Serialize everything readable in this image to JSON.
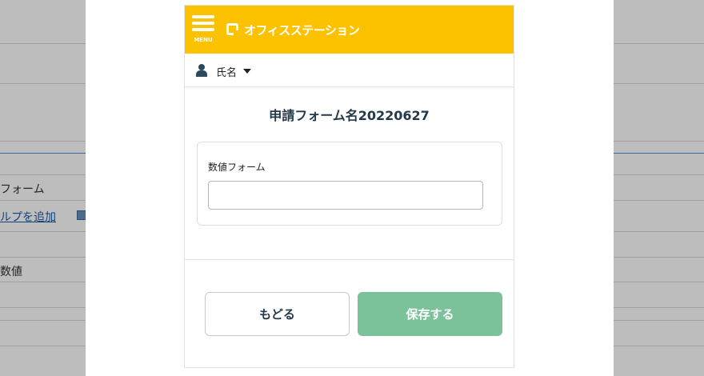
{
  "background": {
    "row1": "フォーム",
    "row2_link": "ルプを追加",
    "row3": "数値"
  },
  "app": {
    "menu_label": "MENU",
    "logo_text": "オフィスステーション"
  },
  "user": {
    "name": "氏名"
  },
  "form": {
    "title": "申請フォーム名20220627",
    "field_label": "数値フォーム",
    "field_value": ""
  },
  "buttons": {
    "back": "もどる",
    "save": "保存する"
  },
  "colors": {
    "header": "#fcc200",
    "save_button": "#7bc29b",
    "title_text": "#23394b"
  }
}
